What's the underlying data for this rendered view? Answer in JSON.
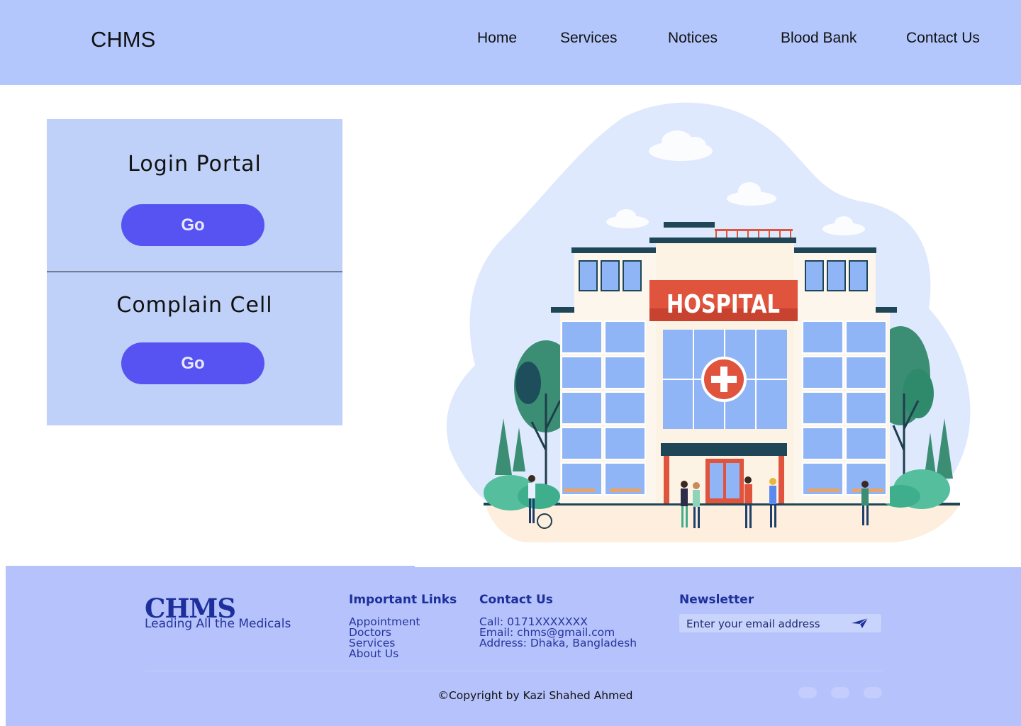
{
  "header": {
    "brand": "CHMS",
    "nav": [
      "Home",
      "Services",
      "Notices",
      "Blood Bank",
      "Contact Us"
    ]
  },
  "portal": {
    "login_title": "Login Portal",
    "login_button": "Go",
    "complain_title": "Complain Cell",
    "complain_button": "Go"
  },
  "illustration": {
    "sign": "HOSPITAL"
  },
  "footer": {
    "logo": "CHMS",
    "tagline": "Leading All the Medicals",
    "links_heading": "Important Links",
    "links": [
      "Appointment",
      "Doctors",
      "Services",
      "About Us"
    ],
    "contact_heading": "Contact Us",
    "contact": [
      "Call: 0171XXXXXXX",
      "Email: chms@gmail.com",
      "Address: Dhaka, Bangladesh"
    ],
    "newsletter_heading": "Newsletter",
    "newsletter_placeholder": "Enter your email address",
    "copyright": "©Copyright by Kazi Shahed Ahmed",
    "social_icons": [
      "linkedin-icon",
      "facebook-icon",
      "instagram-icon"
    ]
  },
  "colors": {
    "header_bg": "#b3c7fc",
    "panel_bg": "#bfd1f8",
    "button_bg": "#5753f2",
    "footer_bg": "#b6c2fb",
    "footer_text": "#1c2f9a",
    "hospital_sign": "#e0533c"
  }
}
